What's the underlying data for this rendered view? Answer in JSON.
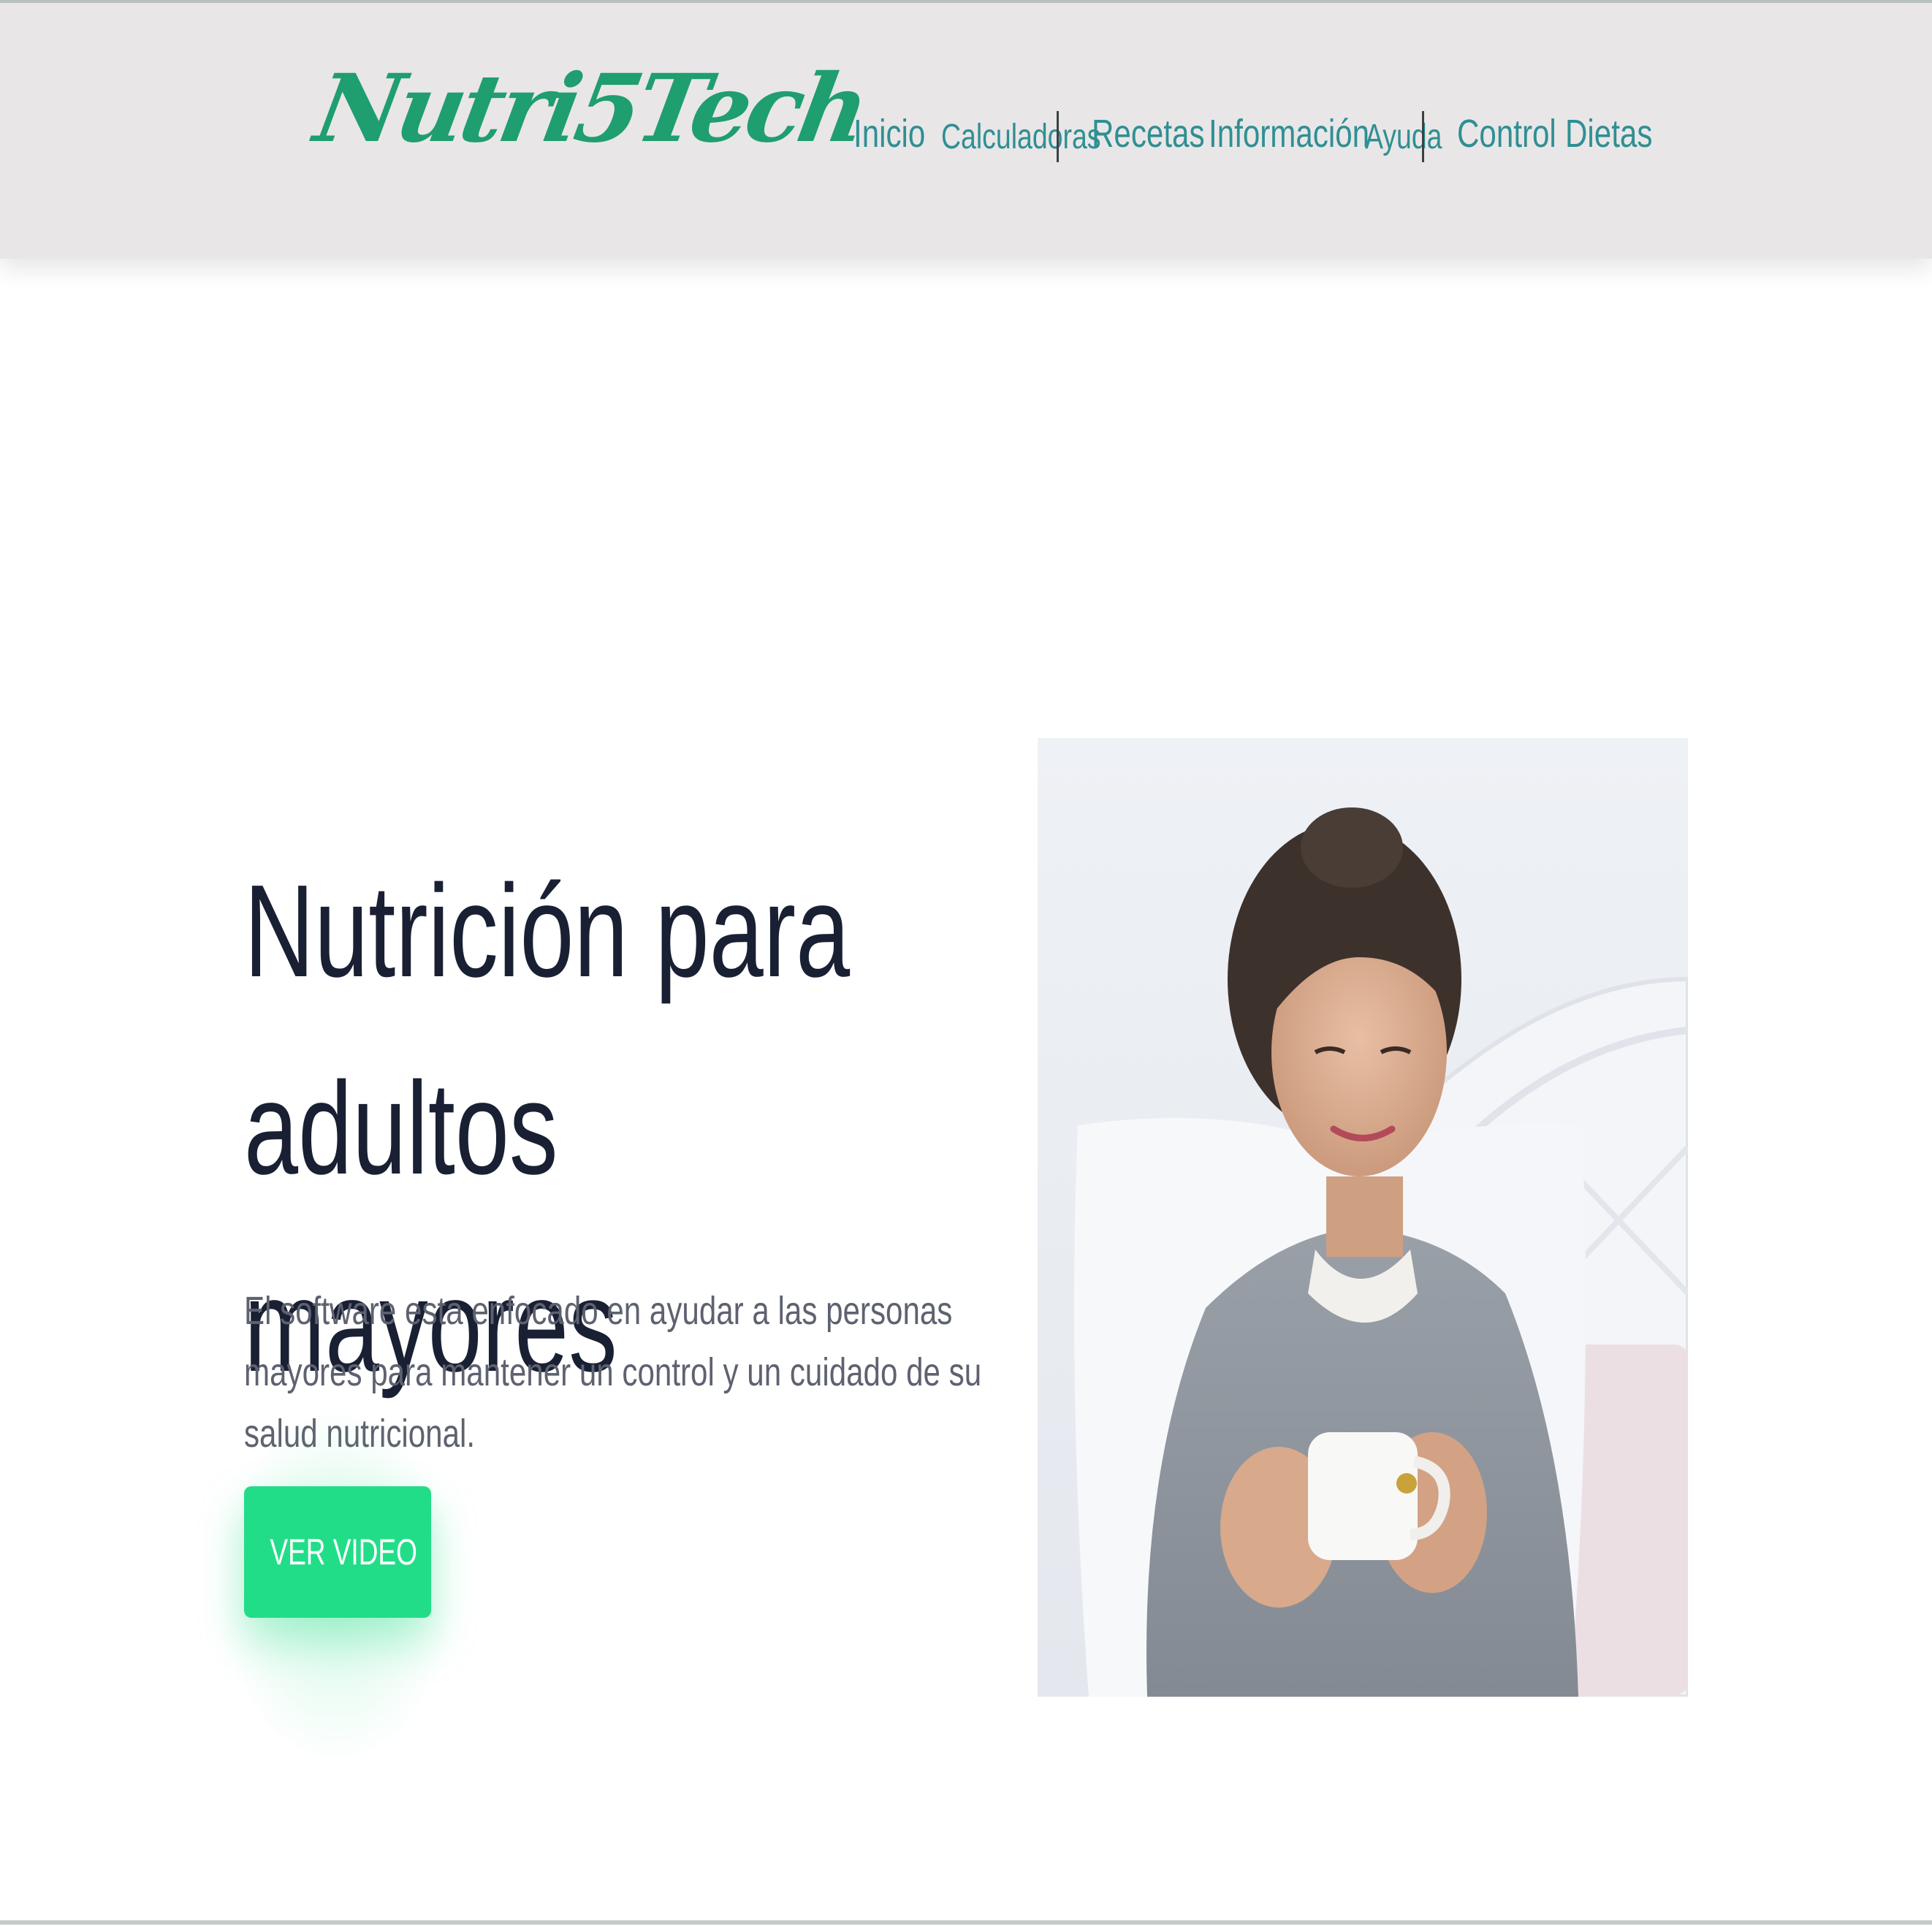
{
  "header": {
    "logo_text": "Nutri5Tech",
    "nav": [
      {
        "label": "Inicio"
      },
      {
        "label": "Calculadoras"
      },
      {
        "label": "Recetas"
      },
      {
        "label": "Información"
      },
      {
        "label": "Ayuda"
      },
      {
        "label": "Control"
      },
      {
        "label": "Dietas"
      }
    ]
  },
  "hero": {
    "title_line1": "Nutrición para adultos",
    "title_line2": "mayores",
    "description": "El software esta enfocado en ayudar a las personas mayores para mantener un control y un cuidado de su salud nutricional.",
    "cta_label": "VER VIDEO",
    "image_subject": "elderly-woman-holding-mug"
  },
  "colors": {
    "brand_green": "#1f9e70",
    "nav_teal": "#2f8f93",
    "cta_green": "#22dd88",
    "header_bg": "#e9e6e7",
    "title_dark": "#1a2033"
  }
}
